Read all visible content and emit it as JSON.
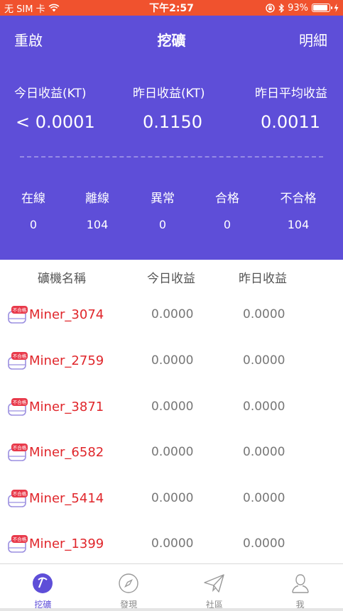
{
  "status_bar": {
    "carrier": "无 SIM 卡",
    "time": "下午2:57",
    "battery": "93%",
    "battery_level": 0.93
  },
  "nav": {
    "left": "重啟",
    "title": "挖礦",
    "right": "明細"
  },
  "earnings": {
    "today_label": "今日收益(KT)",
    "today_value": "< 0.0001",
    "yesterday_label": "昨日收益(KT)",
    "yesterday_value": "0.1150",
    "avg_label": "昨日平均收益",
    "avg_value": "0.0011"
  },
  "stats": {
    "online_label": "在線",
    "online_value": "0",
    "offline_label": "離線",
    "offline_value": "104",
    "abnormal_label": "異常",
    "abnormal_value": "0",
    "qualified_label": "合格",
    "qualified_value": "0",
    "unqualified_label": "不合格",
    "unqualified_value": "104"
  },
  "table": {
    "headers": [
      "礦機名稱",
      "今日收益",
      "昨日收益"
    ],
    "badge": "不合格",
    "rows": [
      {
        "name": "Miner_3074",
        "today": "0.0000",
        "yesterday": "0.0000"
      },
      {
        "name": "Miner_2759",
        "today": "0.0000",
        "yesterday": "0.0000"
      },
      {
        "name": "Miner_3871",
        "today": "0.0000",
        "yesterday": "0.0000"
      },
      {
        "name": "Miner_6582",
        "today": "0.0000",
        "yesterday": "0.0000"
      },
      {
        "name": "Miner_5414",
        "today": "0.0000",
        "yesterday": "0.0000"
      },
      {
        "name": "Miner_1399",
        "today": "0.0000",
        "yesterday": "0.0000"
      }
    ]
  },
  "tabs": [
    {
      "label": "挖礦",
      "icon": "pickaxe-icon",
      "active": true
    },
    {
      "label": "發現",
      "icon": "compass-icon",
      "active": false
    },
    {
      "label": "社區",
      "icon": "paper-plane-icon",
      "active": false
    },
    {
      "label": "我",
      "icon": "user-icon",
      "active": false
    }
  ],
  "colors": {
    "status_bar": "#f0522e",
    "header": "#5e4ed8",
    "miner_name": "#e0262b",
    "badge": "#e8394a"
  }
}
